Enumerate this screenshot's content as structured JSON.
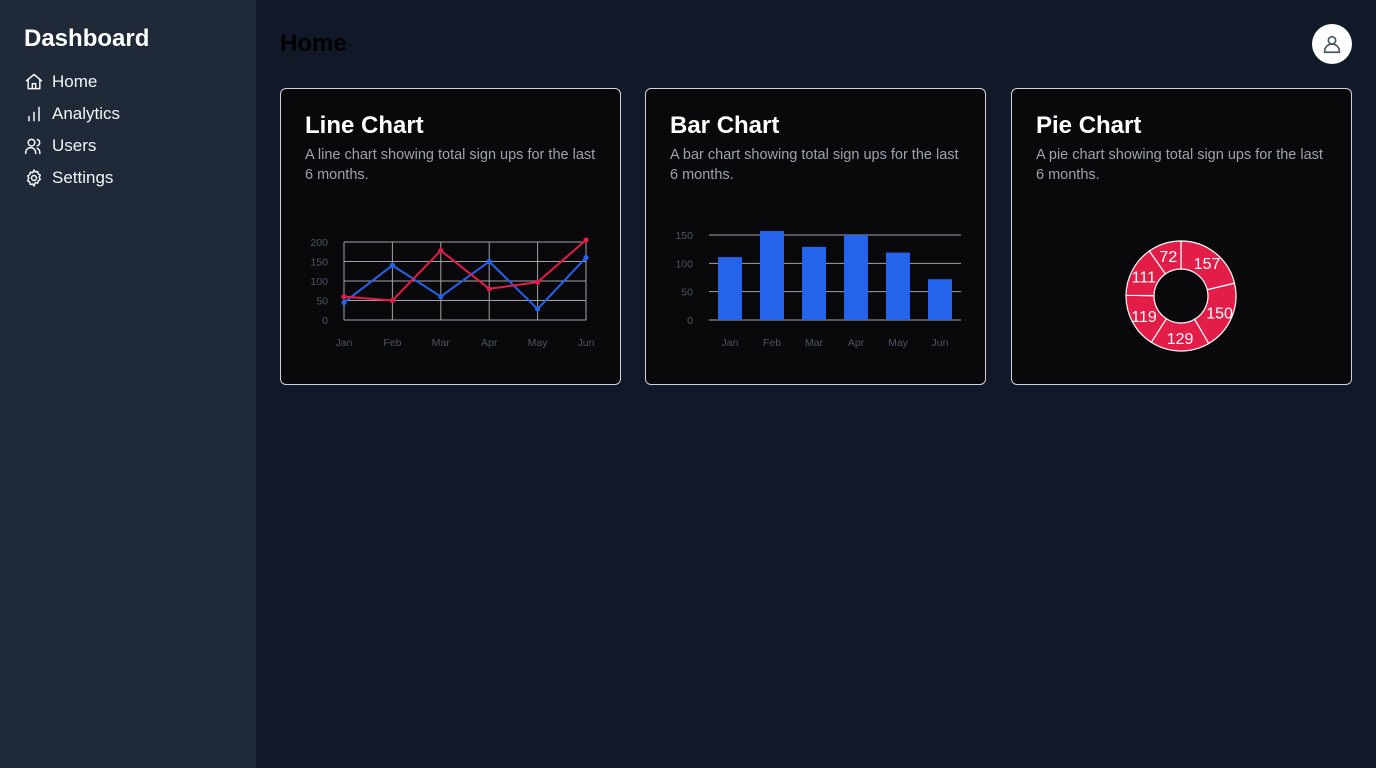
{
  "sidebar": {
    "brand": "Dashboard",
    "items": [
      {
        "label": "Home",
        "icon": "home-icon"
      },
      {
        "label": "Analytics",
        "icon": "bar-chart-icon"
      },
      {
        "label": "Users",
        "icon": "users-icon"
      },
      {
        "label": "Settings",
        "icon": "gear-icon"
      }
    ]
  },
  "header": {
    "title": "Home",
    "avatar_icon": "user-icon"
  },
  "colors": {
    "blue": "#2563eb",
    "red": "#e11d48",
    "sidebar_bg": "#1f2937",
    "page_bg": "#111827",
    "card_bg": "#09090b"
  },
  "cards": [
    {
      "title": "Line Chart",
      "description": "A line chart showing total sign ups for the last 6 months."
    },
    {
      "title": "Bar Chart",
      "description": "A bar chart showing total sign ups for the last 6 months."
    },
    {
      "title": "Pie Chart",
      "description": "A pie chart showing total sign ups for the last 6 months."
    }
  ],
  "chart_data": [
    {
      "type": "line",
      "categories": [
        "Jan",
        "Feb",
        "Mar",
        "Apr",
        "May",
        "Jun"
      ],
      "series": [
        {
          "color": "#2563eb",
          "values": [
            45,
            140,
            60,
            150,
            28,
            160
          ]
        },
        {
          "color": "#e11d48",
          "values": [
            60,
            50,
            178,
            80,
            97,
            205
          ]
        }
      ],
      "yticks": [
        0,
        50,
        100,
        150,
        200
      ],
      "ylim": [
        0,
        200
      ],
      "grid": true
    },
    {
      "type": "bar",
      "categories": [
        "Jan",
        "Feb",
        "Mar",
        "Apr",
        "May",
        "Jun"
      ],
      "values": [
        111,
        157,
        129,
        150,
        119,
        72
      ],
      "yticks": [
        0,
        50,
        100,
        150
      ],
      "ylim": [
        0,
        150
      ],
      "grid": true,
      "color": "#2563eb"
    },
    {
      "type": "pie",
      "values": [
        157,
        150,
        129,
        119,
        111,
        72
      ],
      "labels": [
        "157",
        "150",
        "129",
        "119",
        "111",
        "72"
      ],
      "donut": true,
      "color": "#e11d48"
    }
  ]
}
